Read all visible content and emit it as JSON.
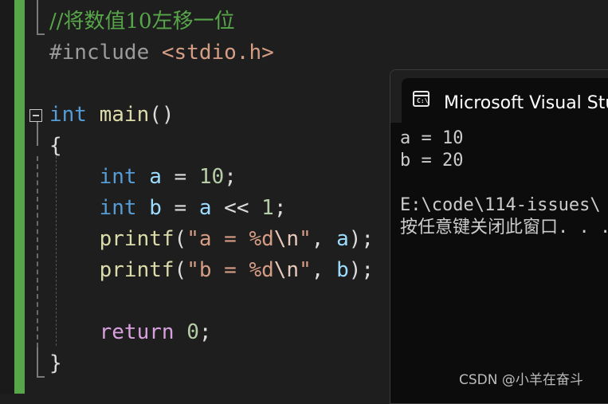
{
  "editor": {
    "code_lines": [
      {
        "parts": [
          {
            "t": "//将数值10左移一位",
            "c": "comment"
          }
        ]
      },
      {
        "parts": [
          {
            "t": "#include ",
            "c": "pre"
          },
          {
            "t": "<stdio.h>",
            "c": "inc"
          }
        ]
      },
      {
        "parts": []
      },
      {
        "parts": [
          {
            "t": "int",
            "c": "kw"
          },
          {
            "t": " ",
            "c": "punc"
          },
          {
            "t": "main",
            "c": "fn"
          },
          {
            "t": "()",
            "c": "punc"
          }
        ]
      },
      {
        "parts": [
          {
            "t": "{",
            "c": "punc"
          }
        ]
      },
      {
        "parts": [
          {
            "t": "    ",
            "c": "punc"
          },
          {
            "t": "int",
            "c": "kw"
          },
          {
            "t": " ",
            "c": "punc"
          },
          {
            "t": "a",
            "c": "var"
          },
          {
            "t": " = ",
            "c": "punc"
          },
          {
            "t": "10",
            "c": "num"
          },
          {
            "t": ";",
            "c": "punc"
          }
        ]
      },
      {
        "parts": [
          {
            "t": "    ",
            "c": "punc"
          },
          {
            "t": "int",
            "c": "kw"
          },
          {
            "t": " ",
            "c": "punc"
          },
          {
            "t": "b",
            "c": "var"
          },
          {
            "t": " = ",
            "c": "punc"
          },
          {
            "t": "a",
            "c": "var"
          },
          {
            "t": " << ",
            "c": "punc"
          },
          {
            "t": "1",
            "c": "num"
          },
          {
            "t": ";",
            "c": "punc"
          }
        ]
      },
      {
        "parts": [
          {
            "t": "    ",
            "c": "punc"
          },
          {
            "t": "printf",
            "c": "fn"
          },
          {
            "t": "(",
            "c": "punc"
          },
          {
            "t": "\"a = %d",
            "c": "str"
          },
          {
            "t": "\\n",
            "c": "esc"
          },
          {
            "t": "\"",
            "c": "str"
          },
          {
            "t": ", ",
            "c": "punc"
          },
          {
            "t": "a",
            "c": "var"
          },
          {
            "t": ");",
            "c": "punc"
          }
        ]
      },
      {
        "parts": [
          {
            "t": "    ",
            "c": "punc"
          },
          {
            "t": "printf",
            "c": "fn"
          },
          {
            "t": "(",
            "c": "punc"
          },
          {
            "t": "\"b = %d",
            "c": "str"
          },
          {
            "t": "\\n",
            "c": "esc"
          },
          {
            "t": "\"",
            "c": "str"
          },
          {
            "t": ", ",
            "c": "punc"
          },
          {
            "t": "b",
            "c": "var"
          },
          {
            "t": ");",
            "c": "punc"
          }
        ]
      },
      {
        "parts": []
      },
      {
        "parts": [
          {
            "t": "    ",
            "c": "punc"
          },
          {
            "t": "return",
            "c": "ret"
          },
          {
            "t": " ",
            "c": "punc"
          },
          {
            "t": "0",
            "c": "num"
          },
          {
            "t": ";",
            "c": "punc"
          }
        ]
      },
      {
        "parts": [
          {
            "t": "}",
            "c": "punc"
          }
        ]
      }
    ]
  },
  "console": {
    "icon": "terminal-icon",
    "title": "Microsoft Visual Studio 调试控制台",
    "output": [
      "a = 10",
      "b = 20",
      "",
      "E:\\code\\114-issues\\",
      "按任意键关闭此窗口. . ."
    ]
  },
  "watermark": "CSDN @小羊在奋斗",
  "colors": {
    "editor_bg": "#1e1e1e",
    "change_bar": "#57a64a",
    "comment": "#57a64a",
    "keyword": "#569cd6",
    "function": "#dcdcaa",
    "variable": "#9cdcfe",
    "number": "#b5cea8",
    "string": "#d69d85",
    "return_kw": "#d8a0df",
    "console_bg": "#0c0c0c"
  }
}
